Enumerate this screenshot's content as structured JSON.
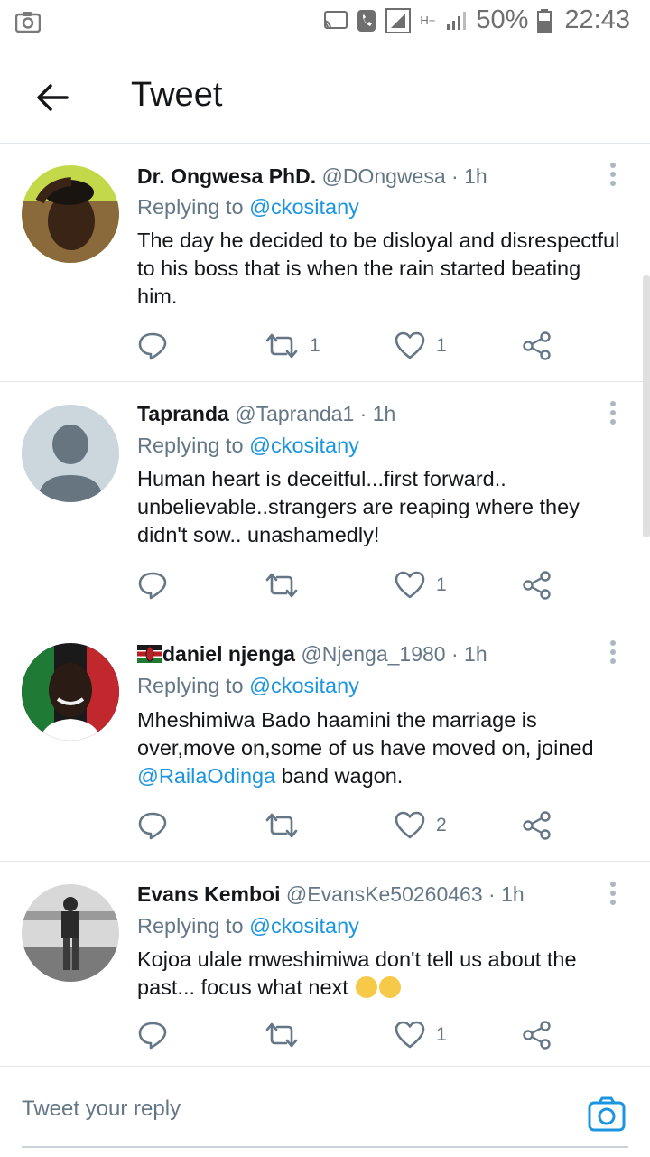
{
  "status_bar": {
    "battery": "50%",
    "time": "22:43",
    "network": "H+"
  },
  "header": {
    "title": "Tweet"
  },
  "tweets": [
    {
      "name": "Dr. Ongwesa PhD.",
      "handle": "@DOngwesa",
      "time": "1h",
      "replying_prefix": "Replying to",
      "replying_to": "@ckositany",
      "text": "The day he decided to be disloyal and disrespectful to his boss that is when the rain started beating him.",
      "retweets": "1",
      "likes": "1"
    },
    {
      "name": "Tapranda",
      "handle": "@Tapranda1",
      "time": "1h",
      "replying_prefix": "Replying to",
      "replying_to": "@ckositany",
      "text": "Human heart is deceitful...first forward.. unbelievable..strangers are reaping where they didn't sow.. unashamedly!",
      "retweets": "",
      "likes": "1"
    },
    {
      "name": "daniel njenga",
      "handle": "@Njenga_1980",
      "time": "1h",
      "replying_prefix": "Replying to",
      "replying_to": "@ckositany",
      "text_before": "Mheshimiwa Bado haamini the marriage is over,move on,some of us have moved on, joined ",
      "text_mention": "@RailaOdinga",
      "text_after": " band wagon.",
      "retweets": "",
      "likes": "2"
    },
    {
      "name": "Evans Kemboi",
      "handle": "@EvansKe50260463",
      "time": "1h",
      "replying_prefix": "Replying to",
      "replying_to": "@ckositany",
      "text": "Kojoa ulale mweshimiwa don't tell us about the past... focus what next",
      "retweets": "",
      "likes": "1"
    }
  ],
  "reply_bar": {
    "placeholder": "Tweet your reply"
  },
  "colors": {
    "accent": "#1b95e0",
    "text": "#14171a",
    "secondary": "#657786",
    "divider": "#e1e8ed"
  },
  "icons": [
    "camera-status-icon",
    "cast-icon",
    "phone-icon",
    "signal-icon",
    "battery-icon",
    "back-arrow-icon",
    "more-vertical-icon",
    "reply-icon",
    "retweet-icon",
    "heart-icon",
    "share-icon",
    "camera-icon"
  ]
}
